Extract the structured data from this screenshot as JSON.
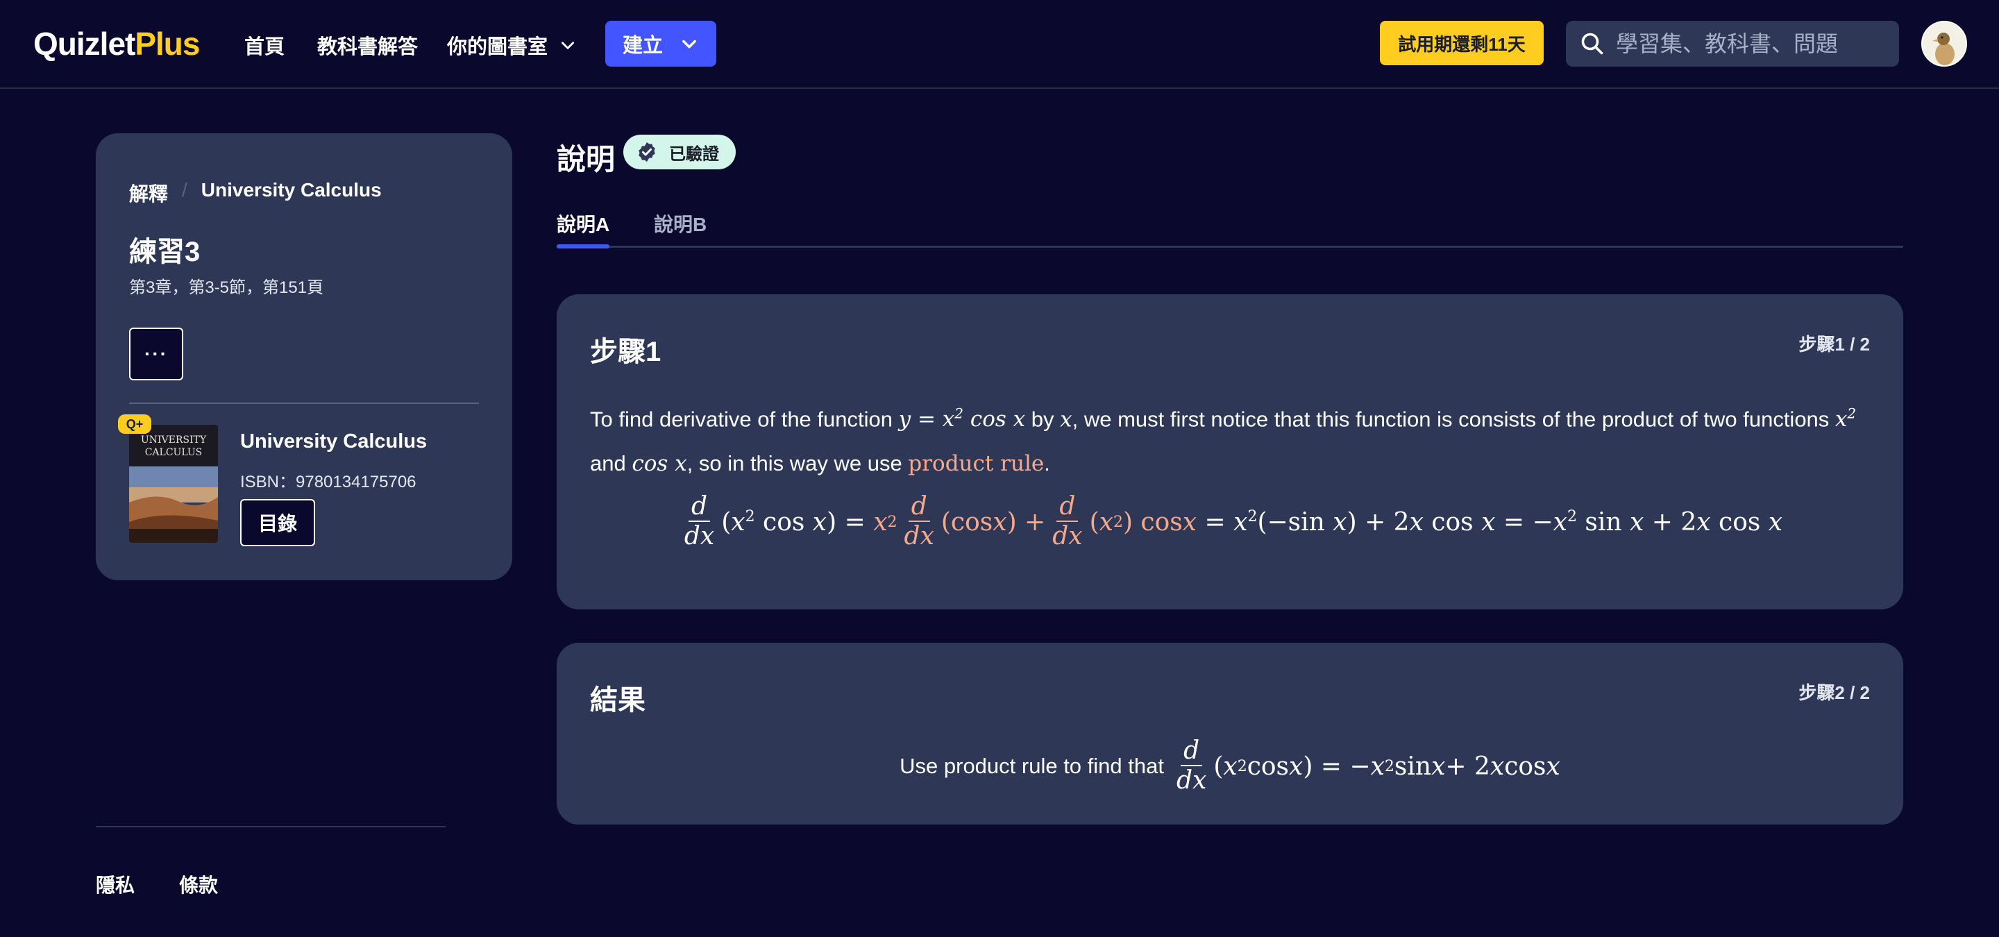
{
  "header": {
    "logo_main": "Quizlet",
    "logo_plus": "Plus",
    "nav_home": "首頁",
    "nav_solutions": "教科書解答",
    "nav_library": "你的圖書室",
    "create_label": "建立",
    "trial_label": "試用期還剩11天",
    "search_placeholder": "學習集、教科書、問題"
  },
  "sidebar": {
    "breadcrumb_root": "解釋",
    "breadcrumb_sep": "/",
    "breadcrumb_book": "University Calculus",
    "exercise_title": "練習3",
    "exercise_sub": "第3章，第3-5節，第151頁",
    "more_label": "···",
    "qplus_badge": "Q+",
    "book_title": "University Calculus",
    "book_isbn": "ISBN：9780134175706",
    "toc_label": "目錄"
  },
  "footer": {
    "privacy": "隱私",
    "terms": "條款"
  },
  "main": {
    "title": "說明",
    "verified_label": "已驗證",
    "tabs": [
      {
        "label": "說明A"
      },
      {
        "label": "說明B"
      }
    ],
    "step1": {
      "title": "步驟1",
      "count": "步驟1 / 2",
      "text_a": "To find derivative of the function ",
      "text_b": " by ",
      "text_c": ", we must first notice that this function is consists of the product of two functions ",
      "text_d": " and ",
      "text_e": ", so in this way we use ",
      "product_rule": "product rule",
      "text_f": "."
    },
    "step2": {
      "title": "結果",
      "count": "步驟2 / 2",
      "text": "Use product rule to find that"
    }
  },
  "colors": {
    "background": "#0a092d",
    "card": "#2e3856",
    "accent_blue": "#4255ff",
    "accent_yellow": "#ffcd1f",
    "highlight_orange": "#f7a98b",
    "verified_bg": "#d4f5e9"
  },
  "icons": [
    "search-icon",
    "chevron-down-icon",
    "verified-check-icon"
  ]
}
